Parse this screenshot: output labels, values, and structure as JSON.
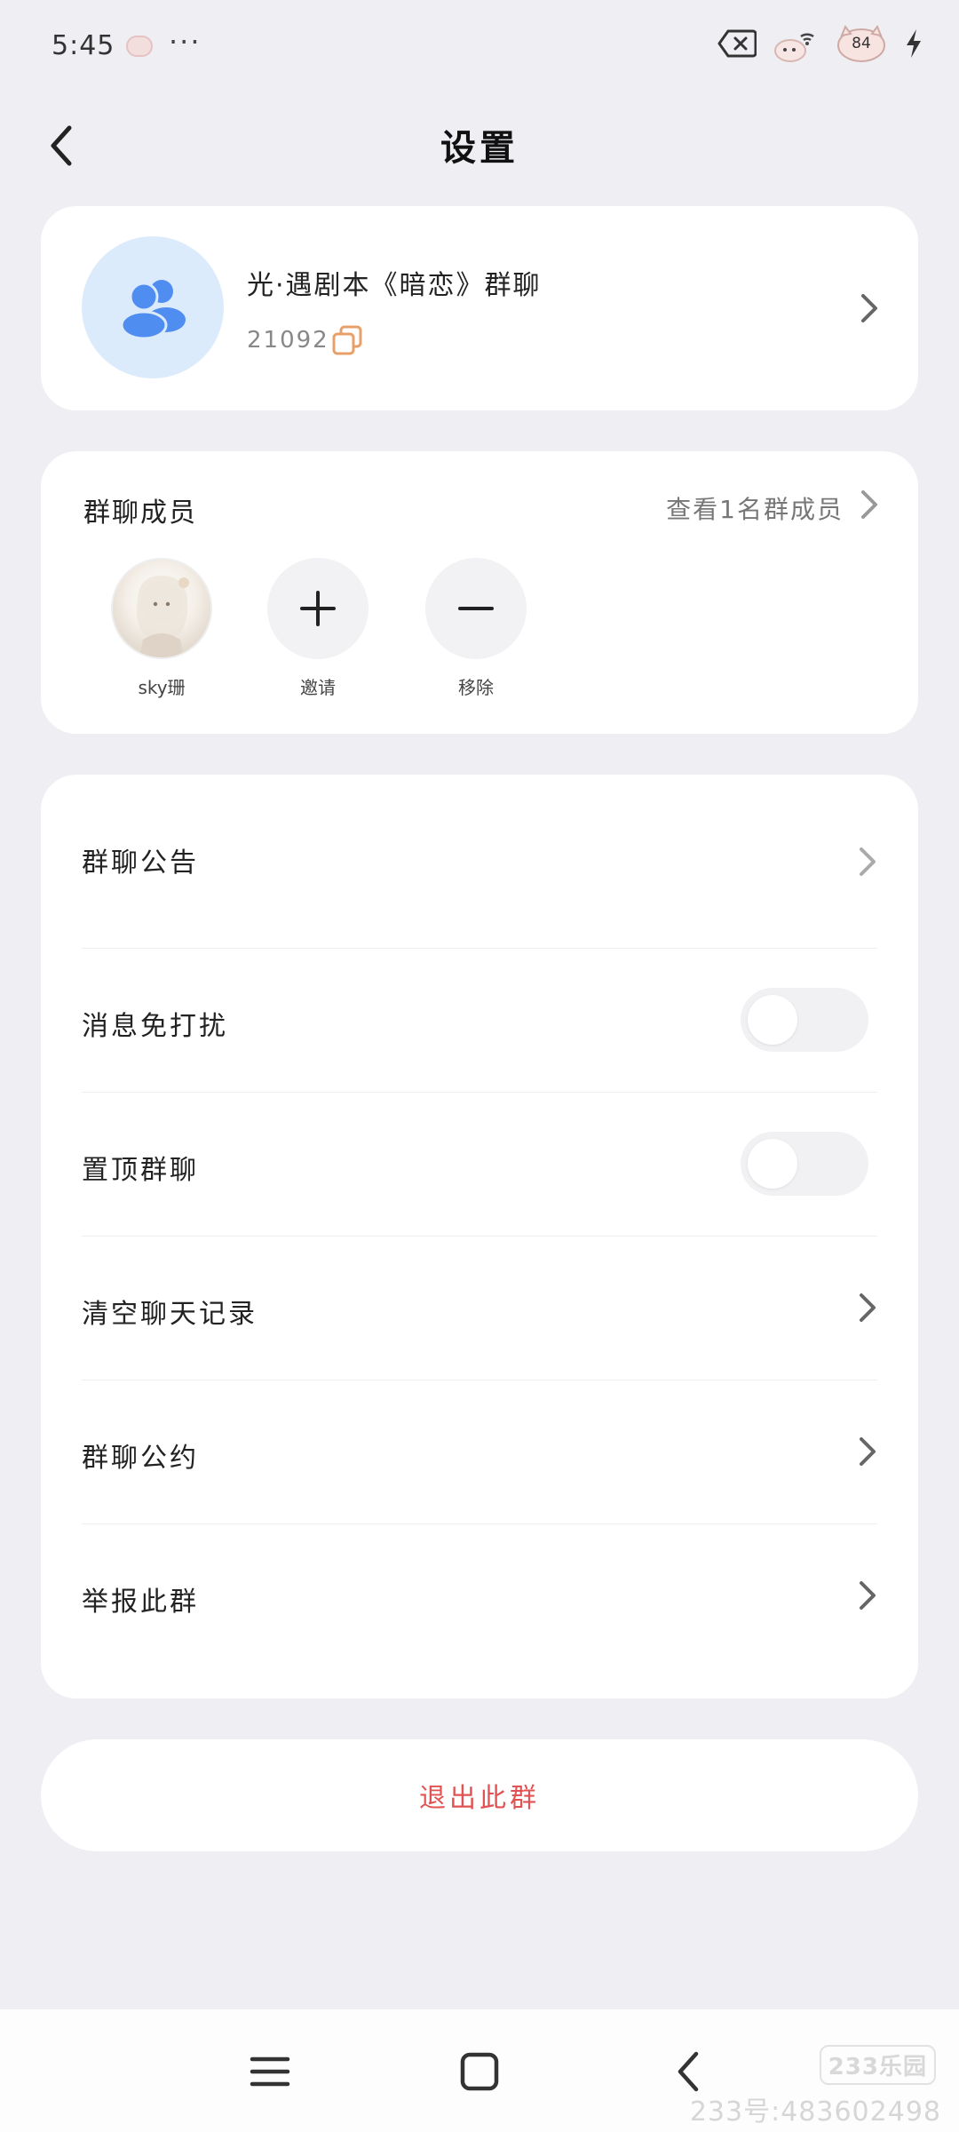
{
  "status_bar": {
    "time": "5:45",
    "dots": "···",
    "battery_level": "84"
  },
  "header": {
    "title": "设置"
  },
  "group": {
    "name": "光·遇剧本《暗恋》群聊",
    "id": "21092"
  },
  "members": {
    "title": "群聊成员",
    "view_all": "查看1名群成员",
    "items": [
      {
        "label": "sky珊"
      },
      {
        "label": "邀请"
      },
      {
        "label": "移除"
      }
    ]
  },
  "settings": [
    {
      "label": "群聊公告",
      "type": "link"
    },
    {
      "label": "消息免打扰",
      "type": "toggle",
      "on": false
    },
    {
      "label": "置顶群聊",
      "type": "toggle",
      "on": false
    },
    {
      "label": "清空聊天记录",
      "type": "link"
    },
    {
      "label": "群聊公约",
      "type": "link"
    },
    {
      "label": "举报此群",
      "type": "link"
    }
  ],
  "exit": {
    "label": "退出此群"
  },
  "watermark": {
    "logo": "233乐园",
    "text": "233号:483602498"
  },
  "colors": {
    "background": "#efeef3",
    "danger": "#e25252",
    "accent_blue": "#4f8df0",
    "copy_orange": "#e8a06a"
  }
}
